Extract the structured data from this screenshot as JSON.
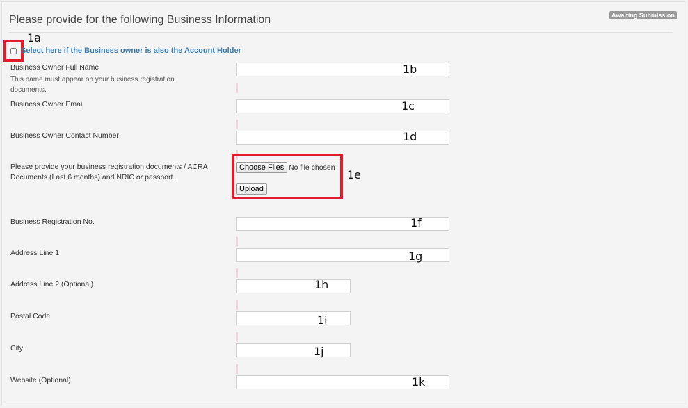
{
  "header": {
    "title": "Please provide for the following Business Information",
    "status_badge": "Awaiting Submission"
  },
  "owner_is_account_holder": {
    "label": "Select here if the Business owner is also the Account Holder",
    "checked": false
  },
  "annotations": [
    "1a",
    "1b",
    "1c",
    "1d",
    "1e",
    "1f",
    "1g",
    "1h",
    "1i",
    "1j",
    "1k"
  ],
  "fields": {
    "owner_name": {
      "label": "Business Owner Full Name",
      "help": "This name must appear on your business registration documents.",
      "value": "",
      "note": "1b"
    },
    "owner_email": {
      "label": "Business Owner Email",
      "value": "",
      "note": "1c"
    },
    "owner_contact": {
      "label": "Business Owner Contact Number",
      "value": "",
      "note": "1d"
    },
    "documents": {
      "label": "Please provide your business registration documents / ACRA Documents (Last 6 months) and NRIC or passport.",
      "choose_label": "Choose Files",
      "status": "No file chosen",
      "upload_label": "Upload",
      "note": "1e"
    },
    "registration_no": {
      "label": "Business Registration No.",
      "value": "",
      "note": "1f"
    },
    "address1": {
      "label": "Address Line 1",
      "value": "",
      "note": "1g"
    },
    "address2": {
      "label": "Address Line 2 (Optional)",
      "value": "",
      "note": "1h"
    },
    "postal_code": {
      "label": "Postal Code",
      "value": "",
      "note": "1i"
    },
    "city": {
      "label": "City",
      "value": "",
      "note": "1j"
    },
    "website": {
      "label": "Website (Optional)",
      "value": "",
      "note": "1k"
    }
  },
  "colors": {
    "highlight": "#e21b2b",
    "link": "#3c78a8",
    "badge": "#999999"
  }
}
